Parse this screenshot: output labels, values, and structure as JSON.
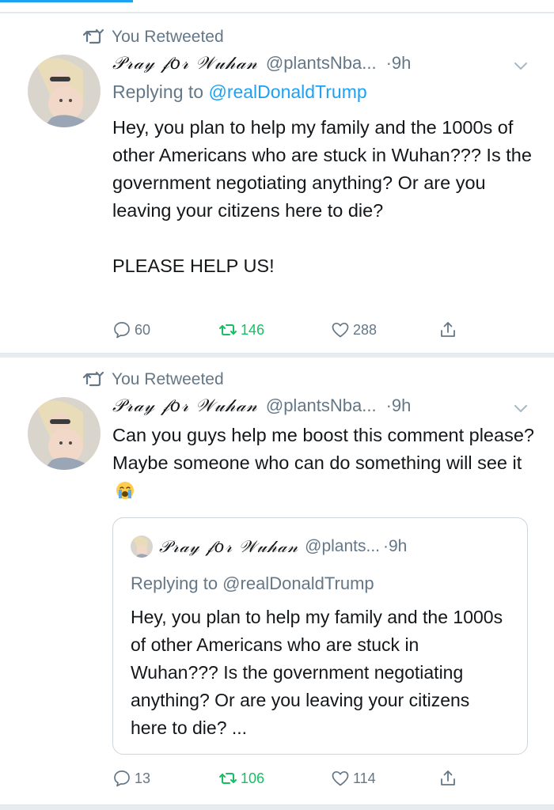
{
  "tweets": [
    {
      "retweet_label": "You Retweeted",
      "display_name": "𝒫𝓇𝒶𝓎 𝒻𝑜𝓇 𝒲𝓊𝒽𝒶𝓃",
      "handle": "@plantsNba...",
      "time": "·9h",
      "replying_prefix": "Replying to ",
      "replying_mention": "@realDonaldTrump",
      "text": "Hey, you plan to help my family and the 1000s of other Americans who are stuck in Wuhan??? Is the government negotiating anything?  Or are you leaving your citizens here to die?\n\nPLEASE HELP US!",
      "replies": "60",
      "retweets": "146",
      "likes": "288"
    },
    {
      "retweet_label": "You Retweeted",
      "display_name": "𝒫𝓇𝒶𝓎 𝒻𝑜𝓇 𝒲𝓊𝒽𝒶𝓃",
      "handle": "@plantsNba...",
      "time": "·9h",
      "text": "Can you guys help me boost this comment please? Maybe someone who can do something will see it",
      "emoji": "loudly-crying-face",
      "quoted": {
        "display_name": "𝒫𝓇𝒶𝓎 𝒻𝑜𝓇 𝒲𝓊𝒽𝒶𝓃",
        "handle": "@plants...",
        "time": "·9h",
        "replying": "Replying to @realDonaldTrump",
        "text": "Hey, you plan to help my family and the 1000s of other Americans who are stuck in Wuhan??? Is the government negotiating anything?  Or are you leaving your citizens here to die? ..."
      },
      "replies": "13",
      "retweets": "106",
      "likes": "114"
    }
  ],
  "colors": {
    "accent": "#1da1f2",
    "retweet_green": "#17bf63",
    "secondary_text": "#657786",
    "divider": "#e1e8ed"
  }
}
